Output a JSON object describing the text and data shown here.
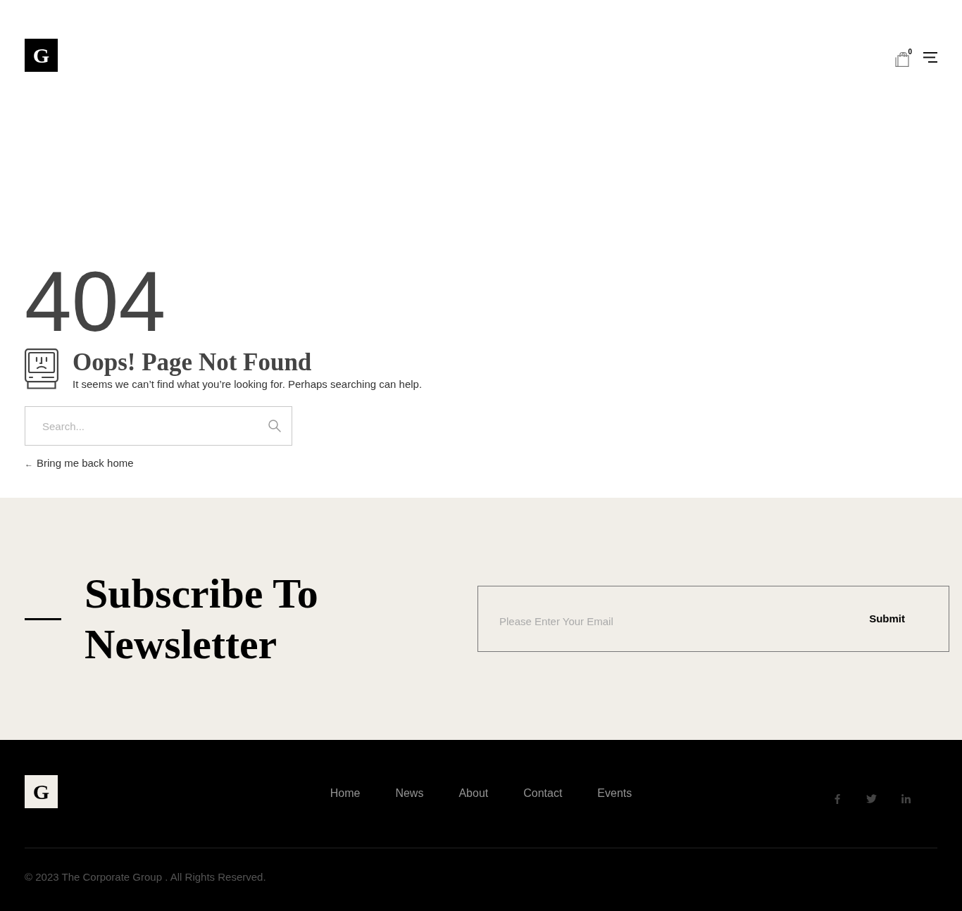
{
  "header": {
    "logo": "G",
    "cart_count": "0"
  },
  "error": {
    "code": "404",
    "title": "Oops! Page Not Found",
    "message": "It seems we can’t find what you’re looking for. Perhaps searching can help.",
    "search": {
      "placeholder": "Search..."
    },
    "back_link": {
      "arrow": "←",
      "label": "Bring me back home"
    }
  },
  "newsletter": {
    "title_lines": [
      "Subscribe To",
      "Newsletter"
    ],
    "email": {
      "placeholder": "Please Enter Your Email"
    },
    "submit": "Submit"
  },
  "footer": {
    "logo": "G",
    "nav": [
      {
        "label": "Home"
      },
      {
        "label": "News"
      },
      {
        "label": "About"
      },
      {
        "label": "Contact"
      },
      {
        "label": "Events"
      }
    ],
    "social": [
      {
        "kind": "facebook"
      },
      {
        "kind": "twitter"
      },
      {
        "kind": "linkedin"
      }
    ],
    "copyright": "© 2023 The Corporate Group . All Rights Reserved."
  }
}
